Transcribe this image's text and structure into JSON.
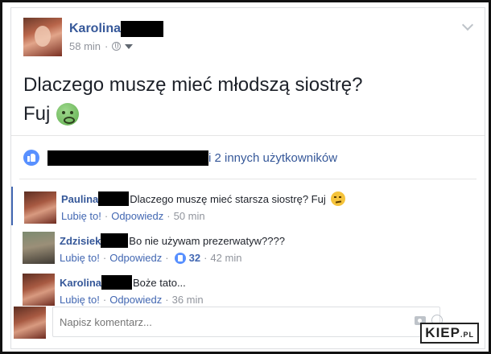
{
  "post": {
    "author": "Karolina",
    "time": "58 min",
    "dot": "·",
    "text_line1": "Dlaczego muszę mieć młodszą siostrę?",
    "text_line2": "Fuj",
    "emoji_icon": "sick-face-icon"
  },
  "likes": {
    "text": "i 2 innych użytkowników",
    "icon": "like-icon"
  },
  "comments": [
    {
      "name": "Paulina",
      "text": "Dlaczego muszę mieć starsza siostrę? Fuj",
      "emoji_icon": "unamused-face-icon",
      "like": "Lubię to!",
      "reply": "Odpowiedz",
      "time": "50 min"
    },
    {
      "name": "Zdzisiek",
      "text": "Bo nie używam prezerwatyw????",
      "like": "Lubię to!",
      "reply": "Odpowiedz",
      "like_count": "32",
      "time": "42 min"
    },
    {
      "name": "Karolina",
      "text": "Boże tato...",
      "like": "Lubię to!",
      "reply": "Odpowiedz",
      "time": "36 min"
    }
  ],
  "composer": {
    "placeholder": "Napisz komentarz..."
  },
  "watermark": {
    "main": "KIEP",
    "suffix": ".PL"
  },
  "colors": {
    "link": "#365899",
    "accent": "#4267b2",
    "meta": "#90949c"
  }
}
